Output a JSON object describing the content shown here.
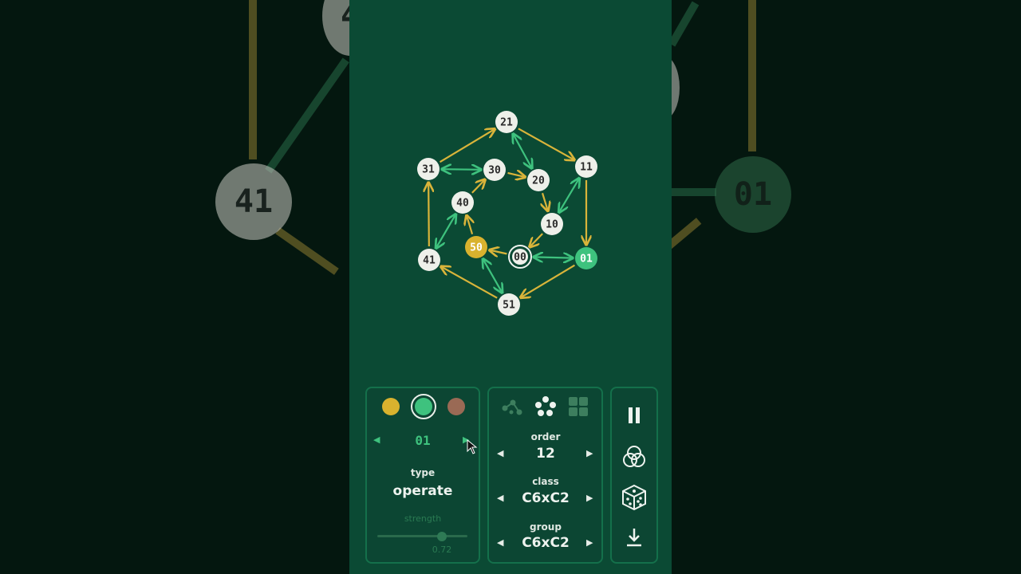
{
  "colors": {
    "background": "#0b4a34",
    "edge_yellow": "#d9b43a",
    "edge_green": "#3ec27e",
    "node_light": "#eef0ea",
    "node_yellow": "#d9b22e",
    "node_green": "#3ec27e",
    "swatch_brown": "#9a6a55"
  },
  "backdrop": {
    "left_node": "41",
    "left_top_node": "4",
    "right_node": "01"
  },
  "graph": {
    "nodes": [
      {
        "id": "21",
        "label": "21",
        "style": "light"
      },
      {
        "id": "11",
        "label": "11",
        "style": "light"
      },
      {
        "id": "31",
        "label": "31",
        "style": "light"
      },
      {
        "id": "30",
        "label": "30",
        "style": "light"
      },
      {
        "id": "20",
        "label": "20",
        "style": "light"
      },
      {
        "id": "40",
        "label": "40",
        "style": "light"
      },
      {
        "id": "10",
        "label": "10",
        "style": "light"
      },
      {
        "id": "50",
        "label": "50",
        "style": "yellow"
      },
      {
        "id": "00",
        "label": "00",
        "style": "ring"
      },
      {
        "id": "01",
        "label": "01",
        "style": "green"
      },
      {
        "id": "41",
        "label": "41",
        "style": "light"
      },
      {
        "id": "51",
        "label": "51",
        "style": "light"
      }
    ],
    "edges": [
      {
        "from": "31",
        "to": "21",
        "color": "yellow",
        "dir": "one"
      },
      {
        "from": "21",
        "to": "11",
        "color": "yellow",
        "dir": "one"
      },
      {
        "from": "11",
        "to": "01",
        "color": "yellow",
        "dir": "one"
      },
      {
        "from": "01",
        "to": "51",
        "color": "yellow",
        "dir": "one"
      },
      {
        "from": "51",
        "to": "41",
        "color": "yellow",
        "dir": "one"
      },
      {
        "from": "41",
        "to": "31",
        "color": "yellow",
        "dir": "one"
      },
      {
        "from": "30",
        "to": "20",
        "color": "yellow",
        "dir": "one"
      },
      {
        "from": "20",
        "to": "10",
        "color": "yellow",
        "dir": "one"
      },
      {
        "from": "10",
        "to": "00",
        "color": "yellow",
        "dir": "one"
      },
      {
        "from": "00",
        "to": "50",
        "color": "yellow",
        "dir": "one"
      },
      {
        "from": "50",
        "to": "40",
        "color": "yellow",
        "dir": "one"
      },
      {
        "from": "40",
        "to": "30",
        "color": "yellow",
        "dir": "one"
      },
      {
        "from": "31",
        "to": "30",
        "color": "green",
        "dir": "both"
      },
      {
        "from": "21",
        "to": "20",
        "color": "green",
        "dir": "both"
      },
      {
        "from": "11",
        "to": "10",
        "color": "green",
        "dir": "both"
      },
      {
        "from": "01",
        "to": "00",
        "color": "green",
        "dir": "both"
      },
      {
        "from": "51",
        "to": "50",
        "color": "green",
        "dir": "both"
      },
      {
        "from": "41",
        "to": "40",
        "color": "green",
        "dir": "both"
      }
    ]
  },
  "generator_panel": {
    "swatches": [
      "yellow",
      "green",
      "brown"
    ],
    "selected_swatch": "green",
    "element_value": "01",
    "prev_icon": "triangle-left-icon",
    "next_icon": "triangle-right-icon",
    "type_label": "type",
    "type_value": "operate",
    "strength_label": "strength",
    "strength_value": "0.72",
    "strength_fraction": 0.72
  },
  "group_panel": {
    "layout_icons": [
      "graph-layout-icon",
      "circle-layout-icon",
      "grid-layout-icon"
    ],
    "selected_layout": "circle-layout-icon",
    "order_label": "order",
    "order_value": "12",
    "class_label": "class",
    "class_value": "C6xC2",
    "group_label": "group",
    "group_value": "C6xC2"
  },
  "action_panel": {
    "icons": [
      "pause-icon",
      "venn-icon",
      "dice-icon",
      "download-icon"
    ]
  }
}
